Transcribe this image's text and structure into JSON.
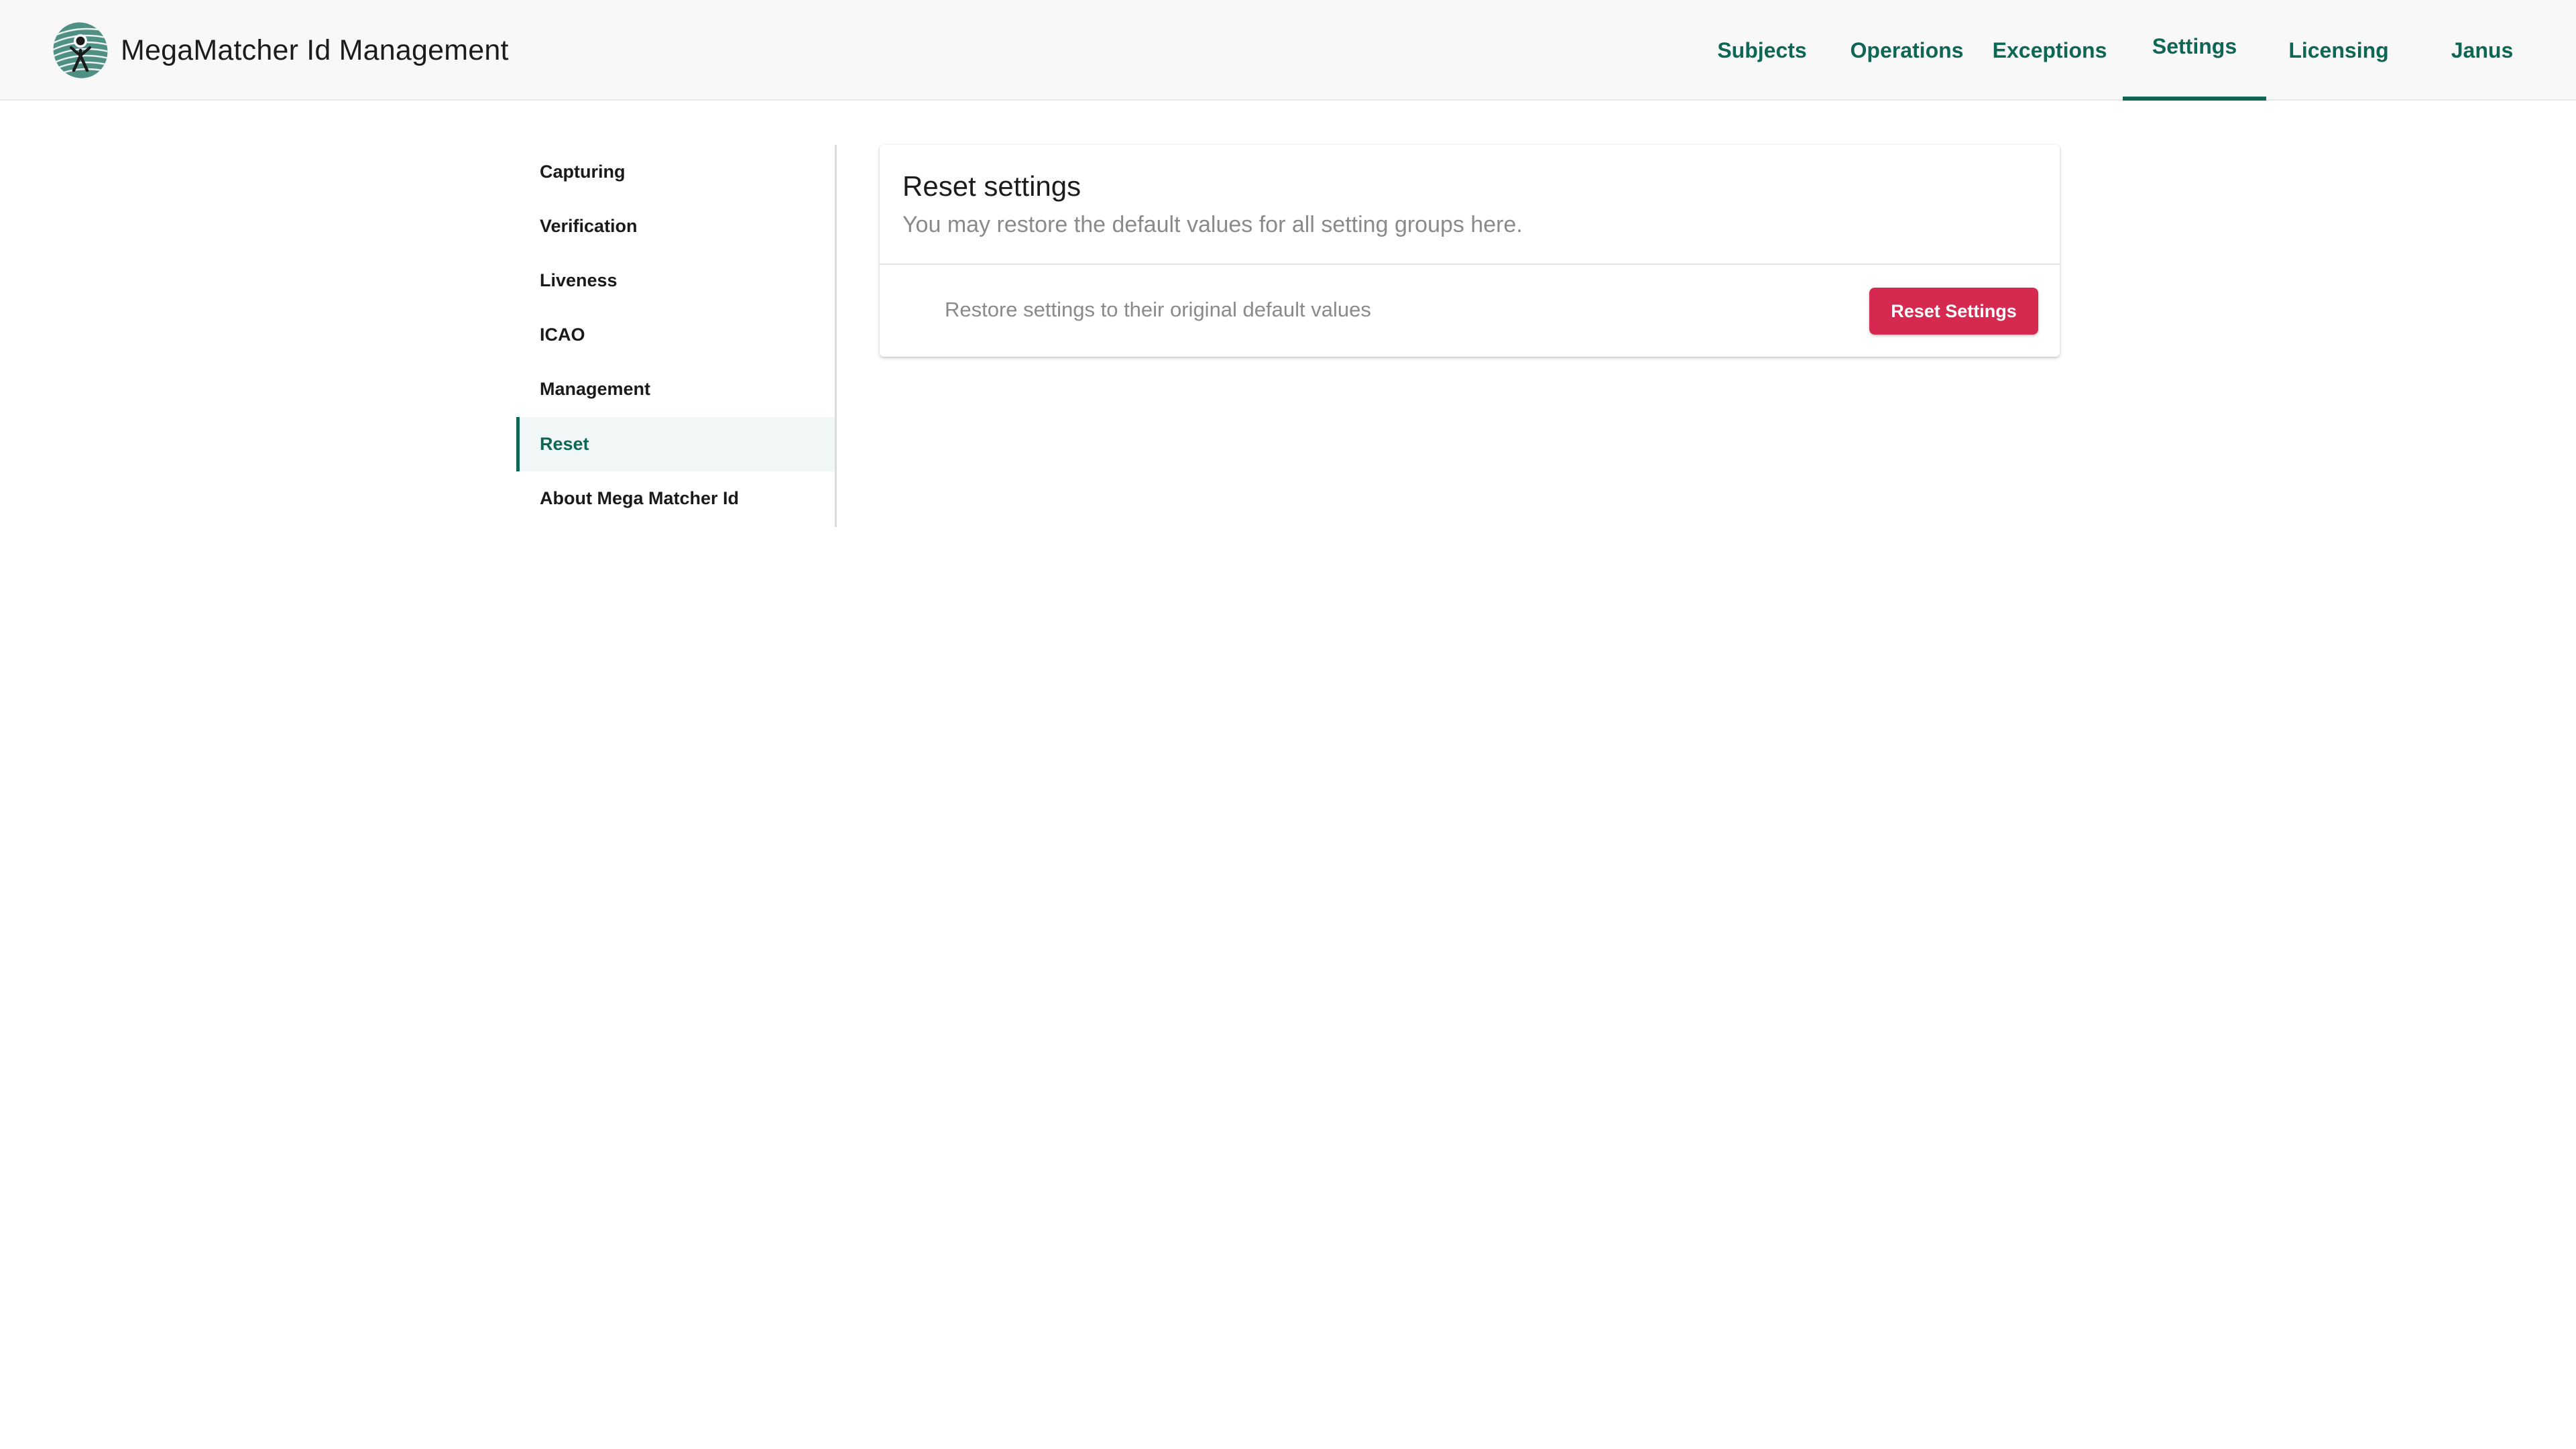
{
  "header": {
    "title": "MegaMatcher Id Management",
    "logo_icon": "fingerprint-person-icon",
    "nav": [
      {
        "label": "Subjects",
        "active": false
      },
      {
        "label": "Operations",
        "active": false
      },
      {
        "label": "Exceptions",
        "active": false
      },
      {
        "label": "Settings",
        "active": true
      },
      {
        "label": "Licensing",
        "active": false
      },
      {
        "label": "Janus",
        "active": false
      }
    ]
  },
  "sidebar": {
    "items": [
      {
        "label": "Capturing",
        "active": false
      },
      {
        "label": "Verification",
        "active": false
      },
      {
        "label": "Liveness",
        "active": false
      },
      {
        "label": "ICAO",
        "active": false
      },
      {
        "label": "Management",
        "active": false
      },
      {
        "label": "Reset",
        "active": true
      },
      {
        "label": "About Mega Matcher Id",
        "active": false
      }
    ]
  },
  "main": {
    "card": {
      "title": "Reset settings",
      "subtitle": "You may restore the default values for all setting groups here.",
      "row_text": "Restore settings to their original default values",
      "button_label": "Reset Settings"
    }
  },
  "colors": {
    "accent": "#0e6655",
    "danger": "#d6294f",
    "header_bg": "#f8f8f8"
  }
}
